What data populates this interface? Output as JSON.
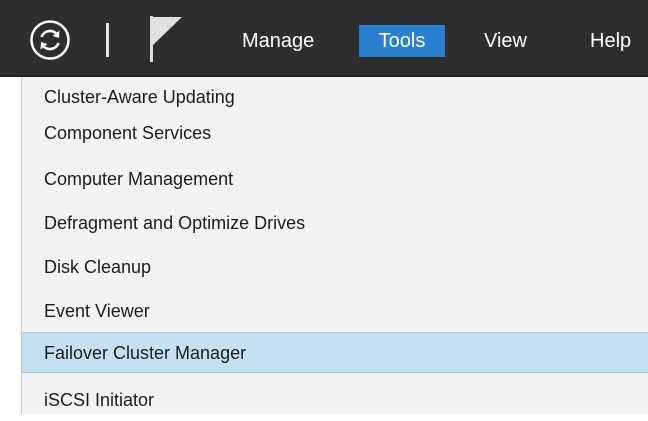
{
  "menubar": {
    "items": [
      {
        "label": "Manage"
      },
      {
        "label": "Tools"
      },
      {
        "label": "View"
      },
      {
        "label": "Help"
      }
    ],
    "active": "Tools"
  },
  "tools_menu": {
    "items": [
      {
        "label": "Cluster-Aware Updating"
      },
      {
        "label": "Component Services"
      },
      {
        "label": "Computer Management"
      },
      {
        "label": "Defragment and Optimize Drives"
      },
      {
        "label": "Disk Cleanup"
      },
      {
        "label": "Event Viewer"
      },
      {
        "label": "Failover Cluster Manager"
      },
      {
        "label": "iSCSI Initiator"
      }
    ],
    "highlighted": "Failover Cluster Manager"
  },
  "icons": {
    "refresh": "refresh-icon",
    "notifications": "flag-icon"
  },
  "colors": {
    "menubar_bg": "#2e2e2e",
    "active_menu_bg": "#2a7fd1",
    "dropdown_bg": "#f3f3f3",
    "highlight_bg": "#c7e0f1"
  }
}
